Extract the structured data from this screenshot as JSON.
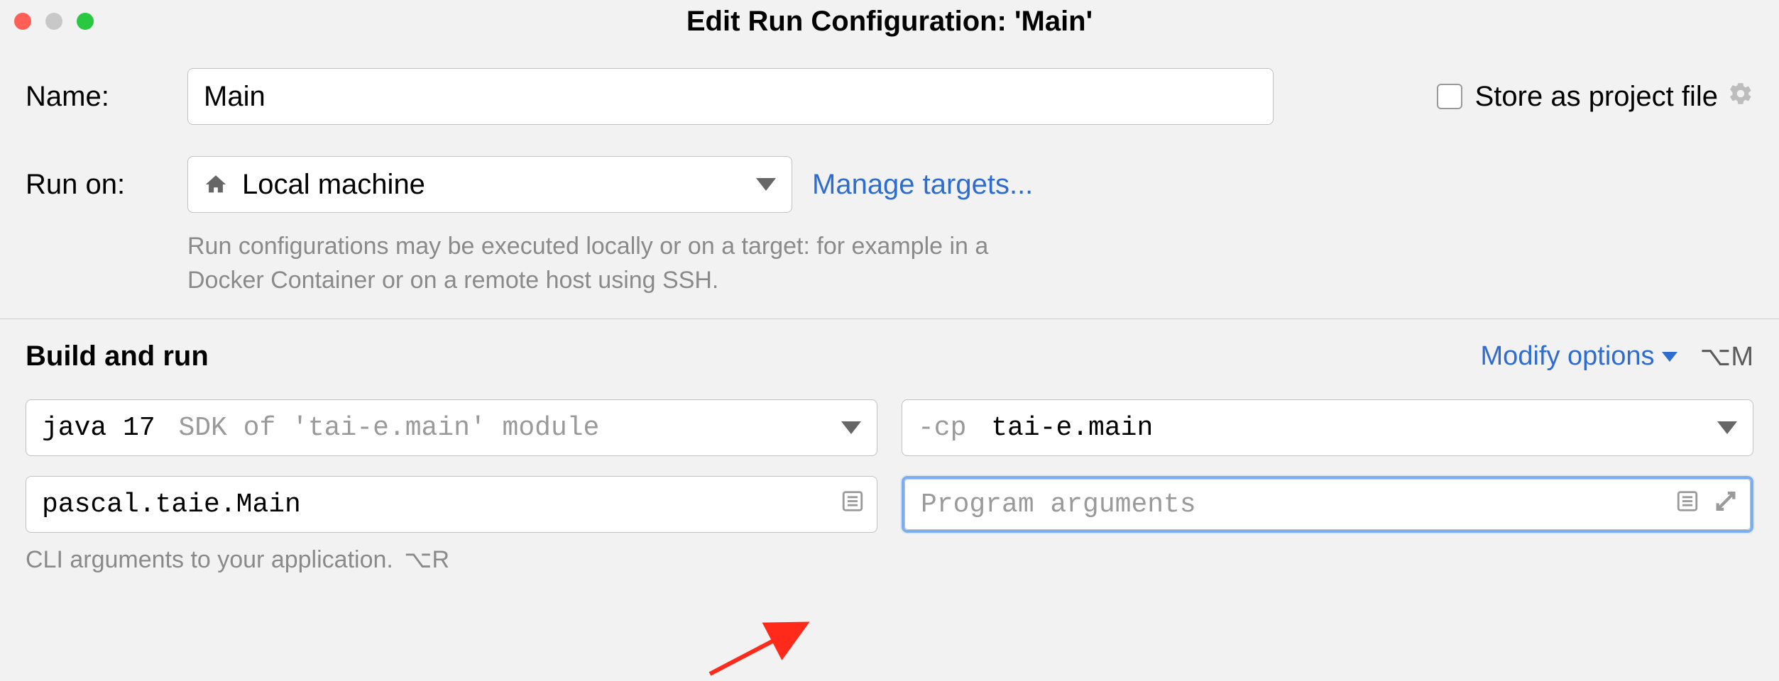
{
  "title": "Edit Run Configuration: 'Main'",
  "nameRow": {
    "label": "Name:",
    "value": "Main",
    "storeLabel": "Store as project file"
  },
  "runOn": {
    "label": "Run on:",
    "selected": "Local machine",
    "manageLink": "Manage targets...",
    "hint": "Run configurations may be executed locally or on a target: for example in a Docker Container or on a remote host using SSH."
  },
  "buildRun": {
    "sectionTitle": "Build and run",
    "modifyLabel": "Modify options",
    "modifyShortcut": "⌥M",
    "jdk": {
      "prefix": "java 17",
      "suffix": "SDK of 'tai-e.main' module"
    },
    "classpath": {
      "prefix": "-cp",
      "value": "tai-e.main"
    },
    "mainClass": "pascal.taie.Main",
    "argsPlaceholder": "Program arguments",
    "footnote": "CLI arguments to your application.",
    "footnoteShortcut": "⌥R"
  }
}
